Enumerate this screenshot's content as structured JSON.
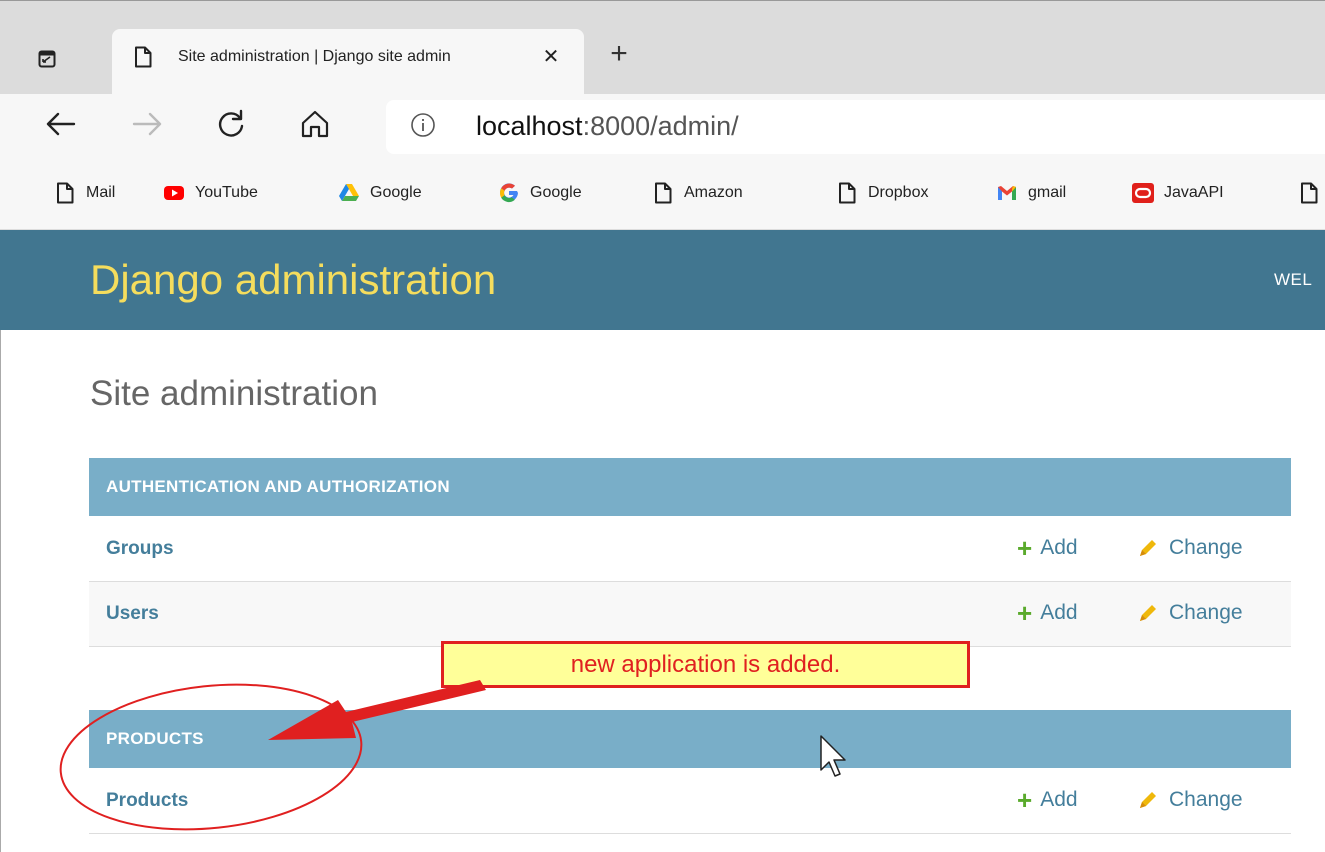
{
  "browser": {
    "tab_title": "Site administration | Django site admin",
    "tab_close": "✕",
    "new_tab": "+",
    "url_host": "localhost",
    "url_path": ":8000/admin/",
    "bookmarks": [
      {
        "label": "Mail",
        "icon": "page-icon"
      },
      {
        "label": "YouTube",
        "icon": "youtube-icon",
        "color": "#ff0000"
      },
      {
        "label": "Google",
        "icon": "google-drive-icon"
      },
      {
        "label": "Google",
        "icon": "google-g-icon"
      },
      {
        "label": "Amazon",
        "icon": "page-icon"
      },
      {
        "label": "Dropbox",
        "icon": "page-icon"
      },
      {
        "label": "gmail",
        "icon": "gmail-icon"
      },
      {
        "label": "JavaAPI",
        "icon": "oracle-icon",
        "color": "#e0201b"
      }
    ]
  },
  "header": {
    "branding": "Django administration",
    "user_tools": "WEL",
    "background": "#417690",
    "branding_color": "#f5dd5d"
  },
  "content": {
    "title": "Site administration",
    "modules": [
      {
        "caption": "AUTHENTICATION AND AUTHORIZATION",
        "rows": [
          {
            "name": "Groups",
            "add": "Add",
            "change": "Change"
          },
          {
            "name": "Users",
            "add": "Add",
            "change": "Change"
          }
        ]
      },
      {
        "caption": "PRODUCTS",
        "rows": [
          {
            "name": "Products",
            "add": "Add",
            "change": "Change"
          }
        ]
      }
    ]
  },
  "annotation": {
    "text": "new application is added.",
    "color": "#e02020",
    "fill": "#ffff99"
  }
}
